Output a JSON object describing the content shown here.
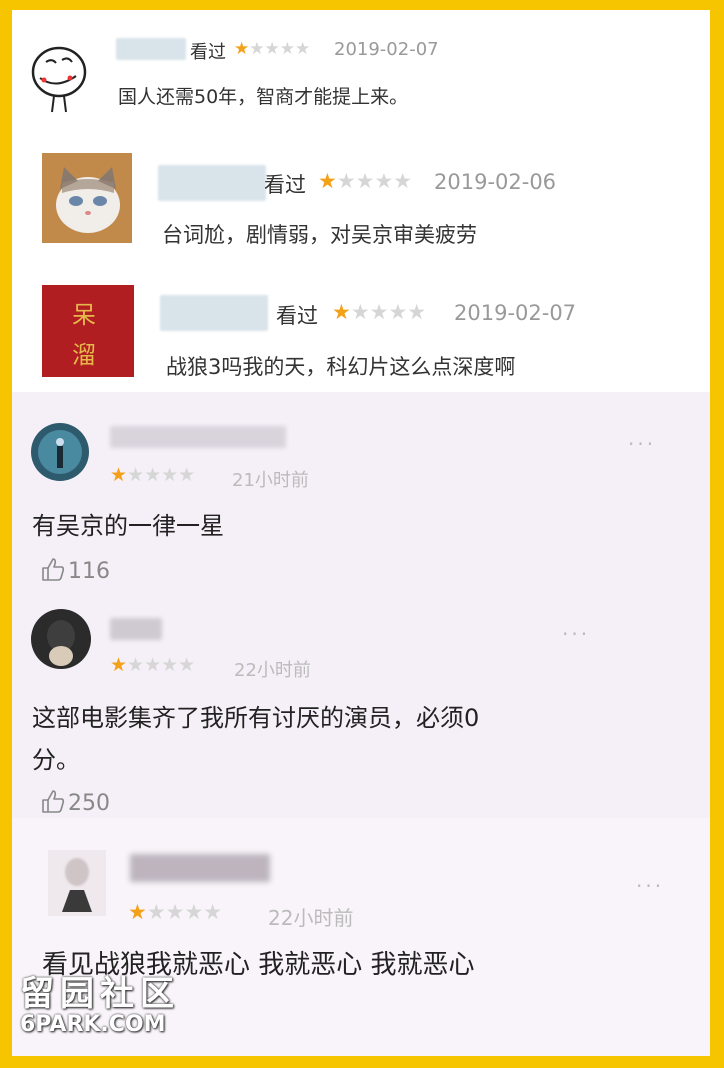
{
  "watched_label": "看过",
  "reviews_top": [
    {
      "date": "2019-02-07",
      "text": "国人还需50年，智商才能提上来。",
      "rating": 1
    },
    {
      "date": "2019-02-06",
      "text": "台词尬，剧情弱，对吴京审美疲劳",
      "rating": 1
    },
    {
      "date": "2019-02-07",
      "text": "战狼3吗我的天，科幻片这么点深度啊",
      "rating": 1
    }
  ],
  "avatar_card_text": [
    "呆",
    "溜"
  ],
  "comments": [
    {
      "time": "21小时前",
      "text": "有吴京的一律一星",
      "likes": "116",
      "rating": 1
    },
    {
      "time": "22小时前",
      "text_line1": "这部电影集齐了我所有讨厌的演员，必须0",
      "text_line2": "分。",
      "likes": "250",
      "rating": 1
    },
    {
      "time": "22小时前",
      "text": "看见战狼我就恶心 我就恶心 我就恶心",
      "rating": 1
    }
  ],
  "more_icon": "···",
  "watermark": {
    "cn": "留园社区",
    "en": "6PARK.COM"
  },
  "colors": {
    "frame": "#f6c500",
    "star_on": "#f4a11a",
    "star_off": "#d6d6d6"
  }
}
